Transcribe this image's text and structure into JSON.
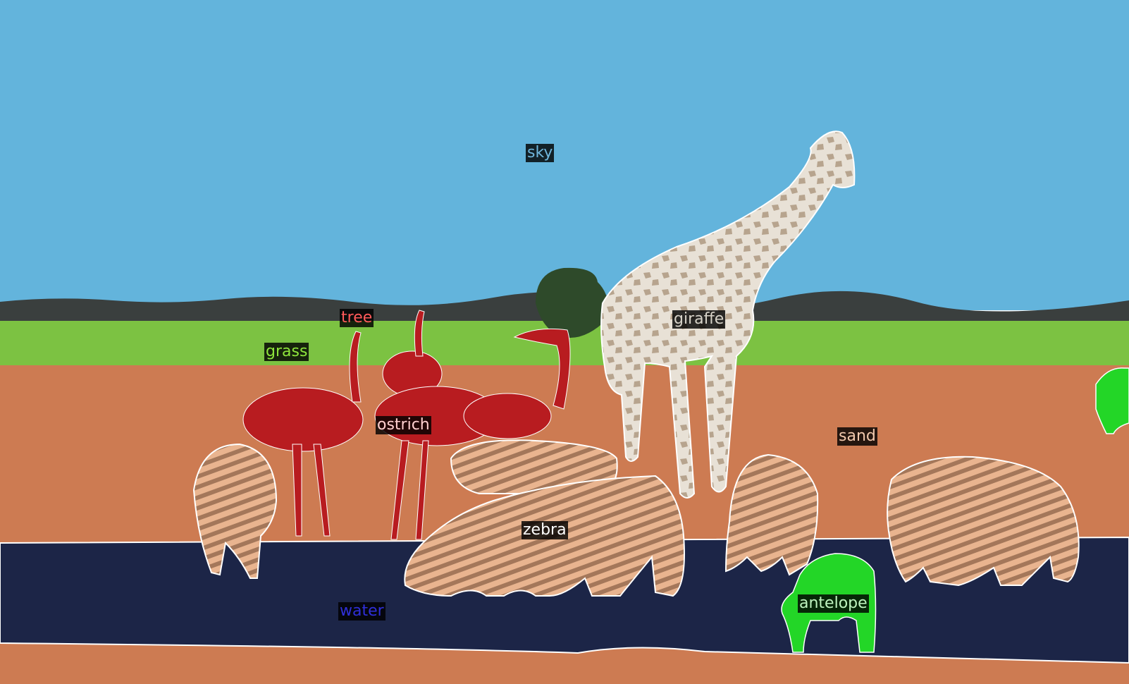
{
  "segments": [
    {
      "key": "sky",
      "label": "sky",
      "color": "#6fb6dc"
    },
    {
      "key": "giraffe",
      "label": "giraffe",
      "color": "#d6d2c8"
    },
    {
      "key": "tree",
      "label": "tree",
      "color": "#ff5a5a"
    },
    {
      "key": "grass",
      "label": "grass",
      "color": "#8ee63c"
    },
    {
      "key": "ostrich",
      "label": "ostrich",
      "color": "#ffd0d0"
    },
    {
      "key": "sand",
      "label": "sand",
      "color": "#f2c9ad"
    },
    {
      "key": "zebra",
      "label": "zebra",
      "color": "#ffffff"
    },
    {
      "key": "water",
      "label": "water",
      "color": "#2f2fd8"
    },
    {
      "key": "antelope",
      "label": "antelope",
      "color": "#bff3bf"
    }
  ]
}
